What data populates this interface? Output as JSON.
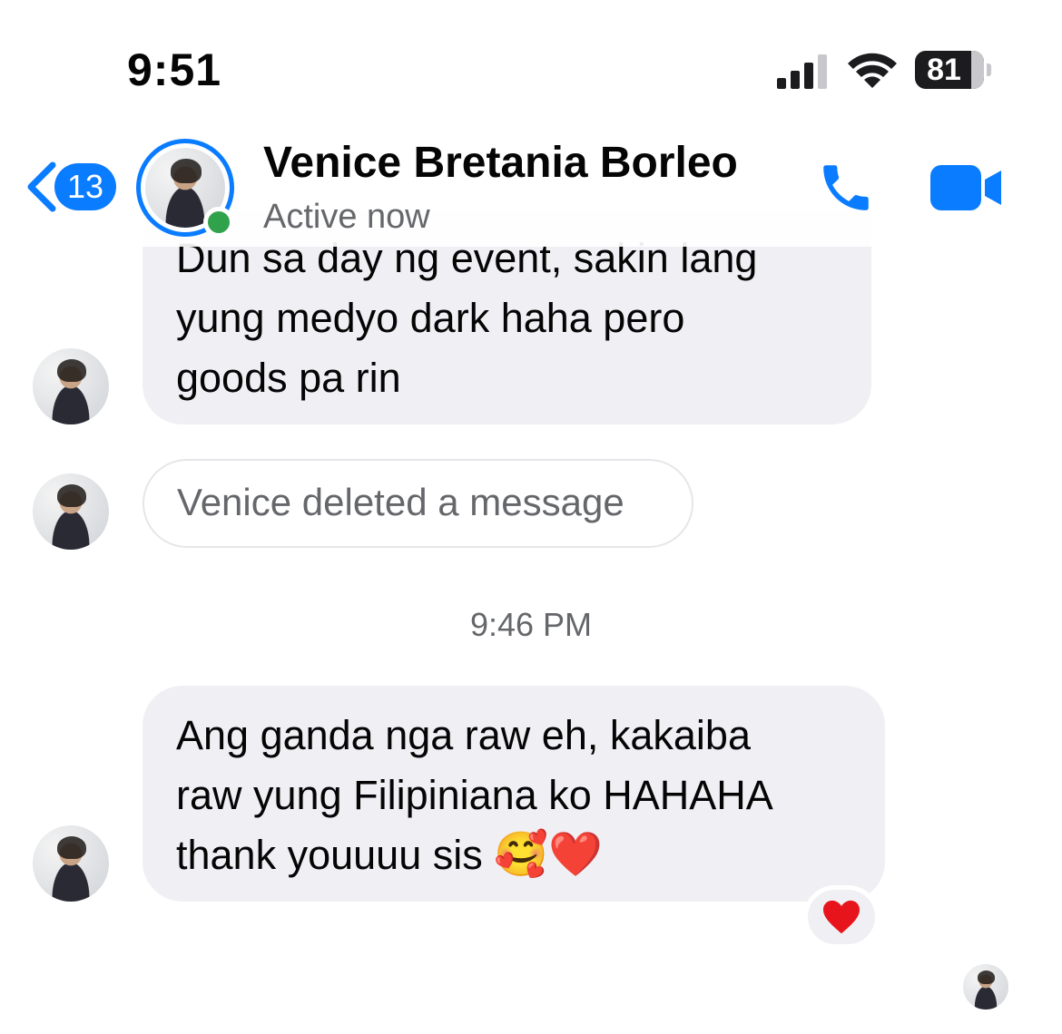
{
  "status_bar": {
    "time": "9:51",
    "battery": "81",
    "battery_level": 0.81
  },
  "header": {
    "back_count": "13",
    "contact_name": "Venice Bretania Borleo",
    "contact_status": "Active now"
  },
  "messages": [
    {
      "lines": [
        "Dun sa day ng event, sakin lang",
        "yung medyo dark haha pero",
        "goods pa rin"
      ]
    },
    {
      "deleted_text": "Venice deleted a message"
    }
  ],
  "timestamp": "9:46 PM",
  "last_message": {
    "lines": [
      "Ang ganda nga raw eh, kakaiba",
      "raw yung Filipiniana ko HAHAHA",
      "thank youuuu sis"
    ],
    "emojis": "🥰❤️",
    "reaction": "❤️"
  },
  "icons": {
    "back": "chevron-left-icon",
    "call": "phone-icon",
    "video": "video-camera-icon",
    "accent": "#0a7cff",
    "online": "#31a24c"
  }
}
